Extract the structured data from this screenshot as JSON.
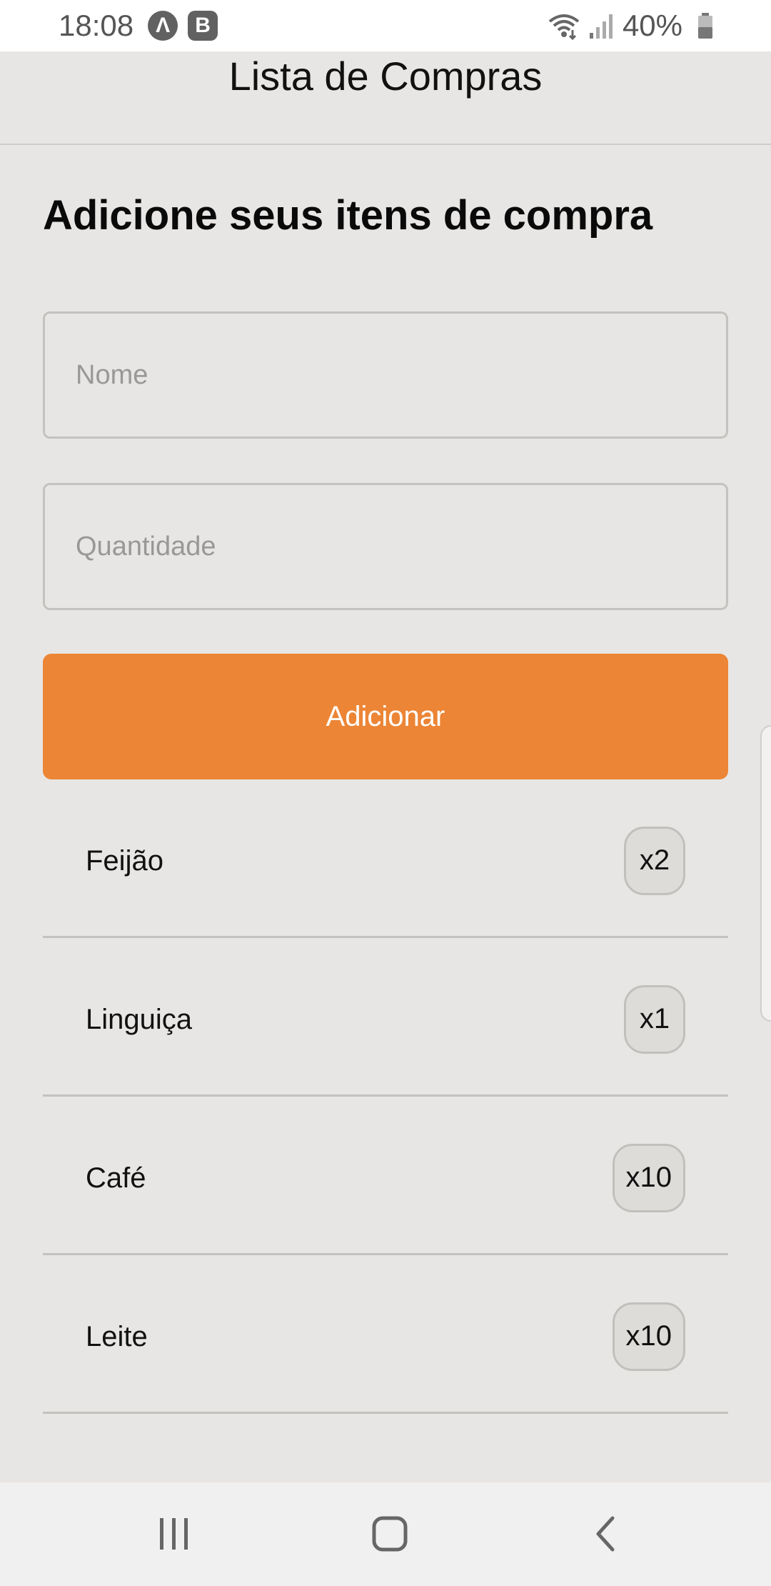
{
  "status_bar": {
    "time": "18:08",
    "badge_a": "Λ",
    "badge_b": "B",
    "battery": "40%",
    "icons": [
      "wifi-icon",
      "signal-icon",
      "battery-icon"
    ]
  },
  "header": {
    "title": "Lista de Compras"
  },
  "form": {
    "heading": "Adicione seus itens de compra",
    "name_placeholder": "Nome",
    "quantity_placeholder": "Quantidade",
    "add_label": "Adicionar"
  },
  "items": [
    {
      "name": "Feijão",
      "qty": "x2"
    },
    {
      "name": "Linguiça",
      "qty": "x1"
    },
    {
      "name": "Café",
      "qty": "x10"
    },
    {
      "name": "Leite",
      "qty": "x10"
    }
  ],
  "nav": {
    "icons": [
      "recents-icon",
      "home-icon",
      "back-icon"
    ]
  },
  "colors": {
    "accent": "#ec8535",
    "background": "#e8e6e4"
  }
}
